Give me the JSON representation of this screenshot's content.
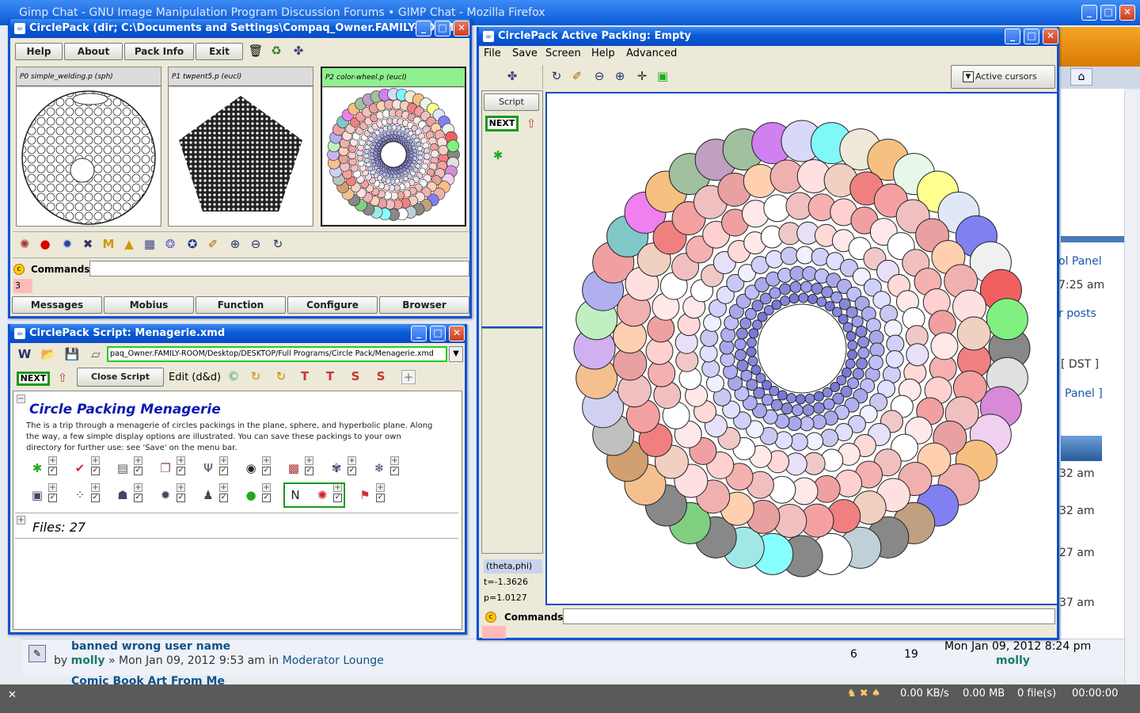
{
  "browser": {
    "title": "Gimp Chat - GNU Image Manipulation Program Discussion Forums • GIMP Chat - Mozilla Firefox"
  },
  "forum": {
    "right_links": [
      "ol Panel",
      "7:25 am",
      "r posts",
      "[ DST ]",
      "Panel ]"
    ],
    "times": [
      "32 am",
      "32 am",
      "27 am",
      "37 am"
    ],
    "row": {
      "title": "banned wrong user name",
      "by": "by",
      "author": "molly",
      "sep": "» Mon Jan 09, 2012 9:53 am in",
      "forum": "Moderator Lounge",
      "replies": "6",
      "views": "19",
      "last_date": "Mon Jan 09, 2012 8:24 pm",
      "last_user": "molly"
    },
    "row2": {
      "title": "Comic Book Art From Me"
    }
  },
  "statusbar": {
    "speed": "0.00 KB/s",
    "mb": "0.00 MB",
    "files": "0 file(s)",
    "time": "00:00:00"
  },
  "cp": {
    "title": "CirclePack (dir; C:\\Documents and Settings\\Compaq_Owner.FAMILY-ROOM)",
    "buttons": [
      "Help",
      "About",
      "Pack Info",
      "Exit"
    ],
    "packs": [
      "P0 simple_welding.p (sph)",
      "P1 twpent5.p (eucl)",
      "P2 color-wheel.p (eucl)"
    ],
    "commands_label": "Commands:",
    "cmd_value": "3",
    "tabs": [
      "Messages",
      "Mobius",
      "Function",
      "Configure",
      "Browser"
    ]
  },
  "script": {
    "title": "CirclePack Script: Menagerie.xmd",
    "path": "paq_Owner.FAMILY-ROOM/Desktop/DESKTOP/Full Programs/Circle Pack/Menagerie.xmd",
    "next": "NEXT",
    "close": "Close Script",
    "edit": "Edit (d&d)",
    "heading": "Circle Packing Menagerie",
    "desc": "The is a trip through a menagerie of circles packings in the plane, sphere, and hyperbolic plane. Along the way, a few simple display options are illustrated. You can save these packings to your own directory for further use: see 'Save' on the menu bar.",
    "files": "Files: 27"
  },
  "active": {
    "title": "CirclePack Active Packing: Empty",
    "menu": [
      "File",
      "Save",
      "Screen",
      "Help",
      "Advanced"
    ],
    "cursors": "Active cursors",
    "script_btn": "Script",
    "next": "NEXT",
    "coord_label": "(theta,phi)",
    "t_val": "t=-1.3626",
    "p_val": "p=1.0127",
    "commands_label": "Commands:"
  },
  "colors": {
    "xp_blue": "#0a52d8",
    "next_green": "#1a9a1a"
  }
}
